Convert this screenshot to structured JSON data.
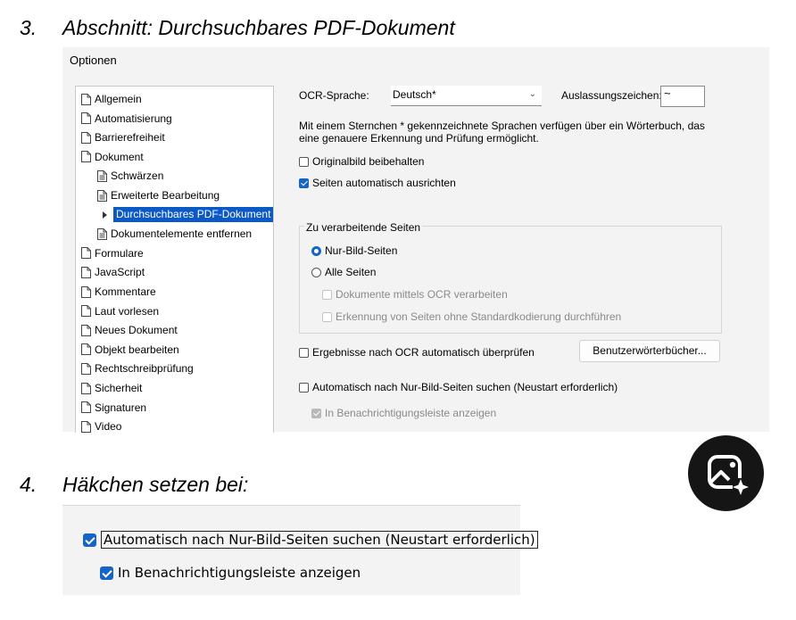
{
  "step3": {
    "number": "3.",
    "title": "Abschnitt: Durchsuchbares PDF-Dokument"
  },
  "step4": {
    "number": "4.",
    "title": "Häkchen setzen bei:"
  },
  "dialog": {
    "title": "Optionen",
    "tree": [
      {
        "label": "Allgemein",
        "level": 0
      },
      {
        "label": "Automatisierung",
        "level": 0
      },
      {
        "label": "Barrierefreiheit",
        "level": 0
      },
      {
        "label": "Dokument",
        "level": 0
      },
      {
        "label": "Schwärzen",
        "level": 1
      },
      {
        "label": "Erweiterte Bearbeitung",
        "level": 1
      },
      {
        "label": "Durchsuchbares PDF-Dokument",
        "level": 1,
        "selected": true
      },
      {
        "label": "Dokumentelemente entfernen",
        "level": 1
      },
      {
        "label": "Formulare",
        "level": 0
      },
      {
        "label": "JavaScript",
        "level": 0
      },
      {
        "label": "Kommentare",
        "level": 0
      },
      {
        "label": "Laut vorlesen",
        "level": 0
      },
      {
        "label": "Neues Dokument",
        "level": 0
      },
      {
        "label": "Objekt bearbeiten",
        "level": 0
      },
      {
        "label": "Rechtschreibprüfung",
        "level": 0
      },
      {
        "label": "Sicherheit",
        "level": 0
      },
      {
        "label": "Signaturen",
        "level": 0
      },
      {
        "label": "Video",
        "level": 0
      }
    ],
    "ocr_language_label": "OCR-Sprache:",
    "ocr_language_value": "Deutsch*",
    "omission_label": "Auslassungszeichen:",
    "omission_value": "~",
    "info_line1": "Mit einem Sternchen * gekennzeichnete Sprachen verfügen über ein Wörterbuch, das",
    "info_line2": "eine genauere Erkennung und Prüfung ermöglicht.",
    "keep_original": {
      "label": "Originalbild beibehalten",
      "checked": false
    },
    "auto_align": {
      "label": "Seiten automatisch ausrichten",
      "checked": true
    },
    "pages_group": {
      "legend": "Zu verarbeitende Seiten",
      "radio_image_only": {
        "label": "Nur-Bild-Seiten",
        "checked": true
      },
      "radio_all": {
        "label": "Alle Seiten",
        "checked": false
      },
      "ocr_docs": {
        "label": "Dokumente mittels OCR verarbeiten",
        "enabled": false
      },
      "non_standard": {
        "label": "Erkennung von Seiten ohne Standardkodierung durchführen",
        "enabled": false
      }
    },
    "auto_check": {
      "label": "Ergebnisse nach OCR automatisch überprüfen",
      "checked": false
    },
    "user_dict_button": "Benutzerwörterbücher...",
    "auto_search": {
      "label": "Automatisch nach Nur-Bild-Seiten suchen (Neustart erforderlich)",
      "checked": false
    },
    "notify_bar": {
      "label": "In Benachrichtigungsleiste anzeigen",
      "checked": true,
      "enabled": false
    }
  },
  "bottom": {
    "auto_search": {
      "label": "Automatisch nach Nur-Bild-Seiten suchen (Neustart erforderlich)",
      "checked": true
    },
    "notify_bar": {
      "label": "In Benachrichtigungsleiste anzeigen",
      "checked": true
    }
  },
  "colors": {
    "accent": "#1565c8",
    "selection": "#0b58c7",
    "badge": "#151515"
  },
  "icons": {
    "tree_page": "page-icon",
    "tree_doc": "document-lines-icon",
    "badge": "photo-sparkle-icon"
  }
}
